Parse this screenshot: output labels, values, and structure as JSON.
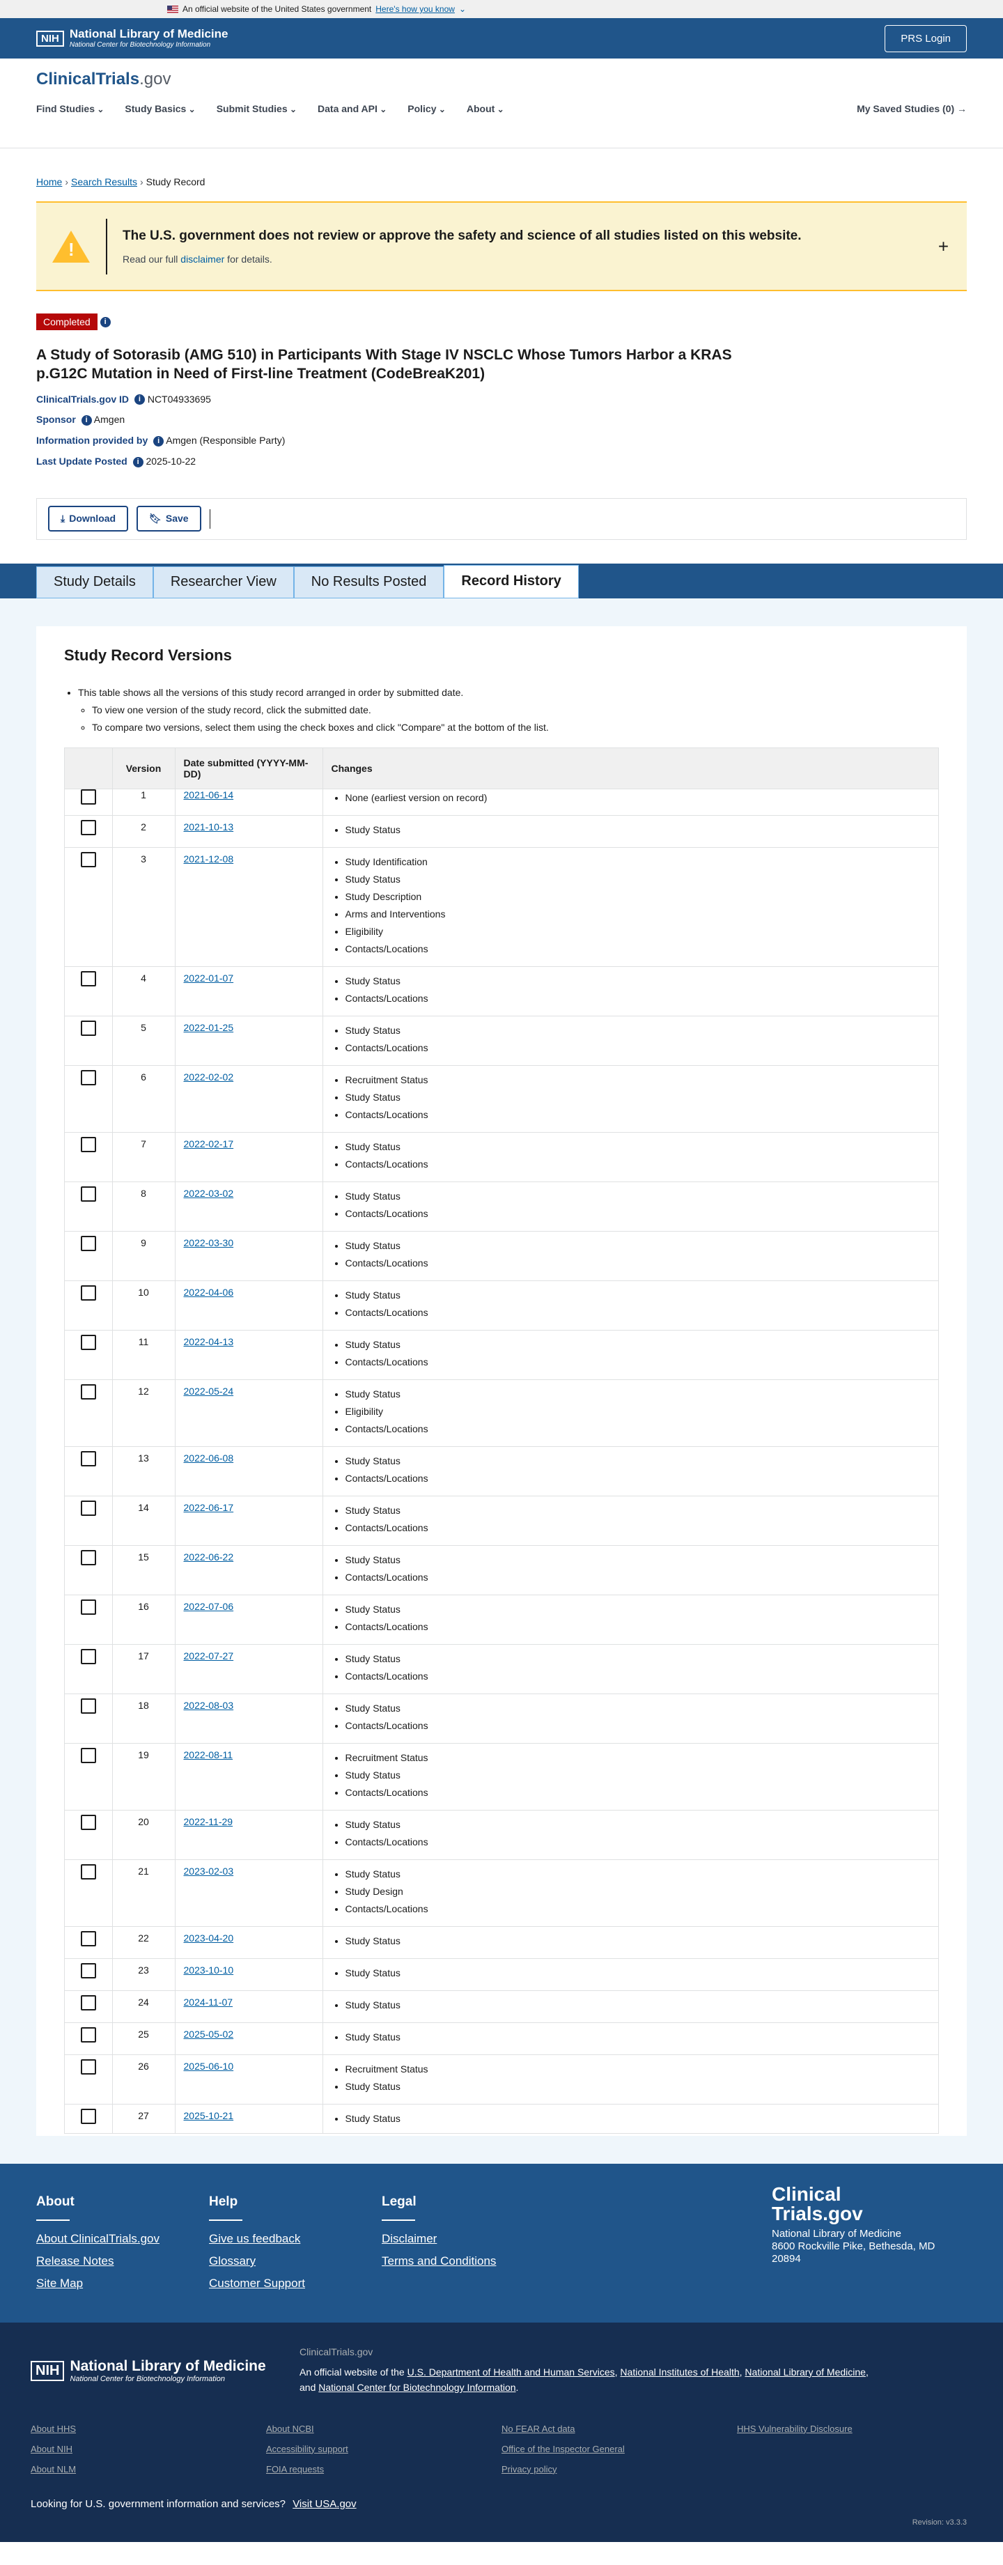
{
  "gov_banner": {
    "text": "An official website of the United States government",
    "link": "Here's how you know"
  },
  "nlm": {
    "nih": "NIH",
    "title": "National Library of Medicine",
    "subtitle": "National Center for Biotechnology Information",
    "prs_login": "PRS Login"
  },
  "site": {
    "logo_main": "ClinicalTrials",
    "logo_suffix": ".gov"
  },
  "menu": [
    "Find Studies",
    "Study Basics",
    "Submit Studies",
    "Data and API",
    "Policy",
    "About"
  ],
  "saved_studies": "My Saved Studies (0) →",
  "breadcrumb": {
    "home": "Home",
    "search": "Search Results",
    "current": "Study Record"
  },
  "alert": {
    "heading": "The U.S. government does not review or approve the safety and science of all studies listed on this website.",
    "pre": "Read our full ",
    "link": "disclaimer",
    "post": " for details."
  },
  "study": {
    "status": "Completed",
    "title": "A Study of Sotorasib (AMG 510) in Participants With Stage IV NSCLC Whose Tumors Harbor a KRAS p.G12C Mutation in Need of First-line Treatment (CodeBreaK201)",
    "id_label": "ClinicalTrials.gov ID",
    "id": "NCT04933695",
    "sponsor_label": "Sponsor",
    "sponsor": "Amgen",
    "info_label": "Information provided by",
    "info": "Amgen (Responsible Party)",
    "updated_label": "Last Update Posted",
    "updated": "2025-10-22"
  },
  "actions": {
    "download": "Download",
    "save": "Save"
  },
  "tabs": [
    "Study Details",
    "Researcher View",
    "No Results Posted",
    "Record History"
  ],
  "versions": {
    "heading": "Study Record Versions",
    "note1": "This table shows all the versions of this study record arranged in order by submitted date.",
    "note2": "To view one version of the study record, click the submitted date.",
    "note3": "To compare two versions, select them using the check boxes and click \"Compare\" at the bottom of the list.",
    "col_version": "Version",
    "col_date": "Date submitted (YYYY-MM-DD)",
    "col_changes": "Changes",
    "rows": [
      {
        "v": "1",
        "d": "2021-06-14",
        "c": [
          "None (earliest version on record)"
        ]
      },
      {
        "v": "2",
        "d": "2021-10-13",
        "c": [
          "Study Status"
        ]
      },
      {
        "v": "3",
        "d": "2021-12-08",
        "c": [
          "Study Identification",
          "Study Status",
          "Study Description",
          "Arms and Interventions",
          "Eligibility",
          "Contacts/Locations"
        ]
      },
      {
        "v": "4",
        "d": "2022-01-07",
        "c": [
          "Study Status",
          "Contacts/Locations"
        ]
      },
      {
        "v": "5",
        "d": "2022-01-25",
        "c": [
          "Study Status",
          "Contacts/Locations"
        ]
      },
      {
        "v": "6",
        "d": "2022-02-02",
        "c": [
          "Recruitment Status",
          "Study Status",
          "Contacts/Locations"
        ]
      },
      {
        "v": "7",
        "d": "2022-02-17",
        "c": [
          "Study Status",
          "Contacts/Locations"
        ]
      },
      {
        "v": "8",
        "d": "2022-03-02",
        "c": [
          "Study Status",
          "Contacts/Locations"
        ]
      },
      {
        "v": "9",
        "d": "2022-03-30",
        "c": [
          "Study Status",
          "Contacts/Locations"
        ]
      },
      {
        "v": "10",
        "d": "2022-04-06",
        "c": [
          "Study Status",
          "Contacts/Locations"
        ]
      },
      {
        "v": "11",
        "d": "2022-04-13",
        "c": [
          "Study Status",
          "Contacts/Locations"
        ]
      },
      {
        "v": "12",
        "d": "2022-05-24",
        "c": [
          "Study Status",
          "Eligibility",
          "Contacts/Locations"
        ]
      },
      {
        "v": "13",
        "d": "2022-06-08",
        "c": [
          "Study Status",
          "Contacts/Locations"
        ]
      },
      {
        "v": "14",
        "d": "2022-06-17",
        "c": [
          "Study Status",
          "Contacts/Locations"
        ]
      },
      {
        "v": "15",
        "d": "2022-06-22",
        "c": [
          "Study Status",
          "Contacts/Locations"
        ]
      },
      {
        "v": "16",
        "d": "2022-07-06",
        "c": [
          "Study Status",
          "Contacts/Locations"
        ]
      },
      {
        "v": "17",
        "d": "2022-07-27",
        "c": [
          "Study Status",
          "Contacts/Locations"
        ]
      },
      {
        "v": "18",
        "d": "2022-08-03",
        "c": [
          "Study Status",
          "Contacts/Locations"
        ]
      },
      {
        "v": "19",
        "d": "2022-08-11",
        "c": [
          "Recruitment Status",
          "Study Status",
          "Contacts/Locations"
        ]
      },
      {
        "v": "20",
        "d": "2022-11-29",
        "c": [
          "Study Status",
          "Contacts/Locations"
        ]
      },
      {
        "v": "21",
        "d": "2023-02-03",
        "c": [
          "Study Status",
          "Study Design",
          "Contacts/Locations"
        ]
      },
      {
        "v": "22",
        "d": "2023-04-20",
        "c": [
          "Study Status"
        ]
      },
      {
        "v": "23",
        "d": "2023-10-10",
        "c": [
          "Study Status"
        ]
      },
      {
        "v": "24",
        "d": "2024-11-07",
        "c": [
          "Study Status"
        ]
      },
      {
        "v": "25",
        "d": "2025-05-02",
        "c": [
          "Study Status"
        ]
      },
      {
        "v": "26",
        "d": "2025-06-10",
        "c": [
          "Recruitment Status",
          "Study Status"
        ]
      },
      {
        "v": "27",
        "d": "2025-10-21",
        "c": [
          "Study Status"
        ]
      }
    ]
  },
  "footer": {
    "about": {
      "heading": "About",
      "links": [
        "About ClinicalTrials.gov",
        "Release Notes",
        "Site Map"
      ]
    },
    "help": {
      "heading": "Help",
      "links": [
        "Give us feedback",
        "Glossary",
        "Customer Support"
      ]
    },
    "legal": {
      "heading": "Legal",
      "links": [
        "Disclaimer",
        "Terms and Conditions"
      ]
    },
    "brand_line1": "Clinical",
    "brand_line2": "Trials.gov",
    "addr1": "National Library of Medicine",
    "addr2": "8600 Rockville Pike, Bethesda, MD",
    "addr3": "20894"
  },
  "footer2": {
    "site": "ClinicalTrials.gov",
    "official_pre": "An official website of the",
    "hhs": "U.S. Department of Health and Human Services",
    "nih": "National Institutes of Health",
    "nlm": "National Library of Medicine",
    "and": "and",
    "ncbi": "National Center for Biotechnology Information",
    "col1": [
      "About HHS",
      "About NIH",
      "About NLM"
    ],
    "col2": [
      "About NCBI",
      "Accessibility support",
      "FOIA requests"
    ],
    "col3": [
      "No FEAR Act data",
      "Office of the Inspector General",
      "Privacy policy"
    ],
    "col4": [
      "HHS Vulnerability Disclosure"
    ],
    "usa_text": "Looking for U.S. government information and services?",
    "usa_link": "Visit USA.gov",
    "revision": "Revision: v3.3.3"
  }
}
